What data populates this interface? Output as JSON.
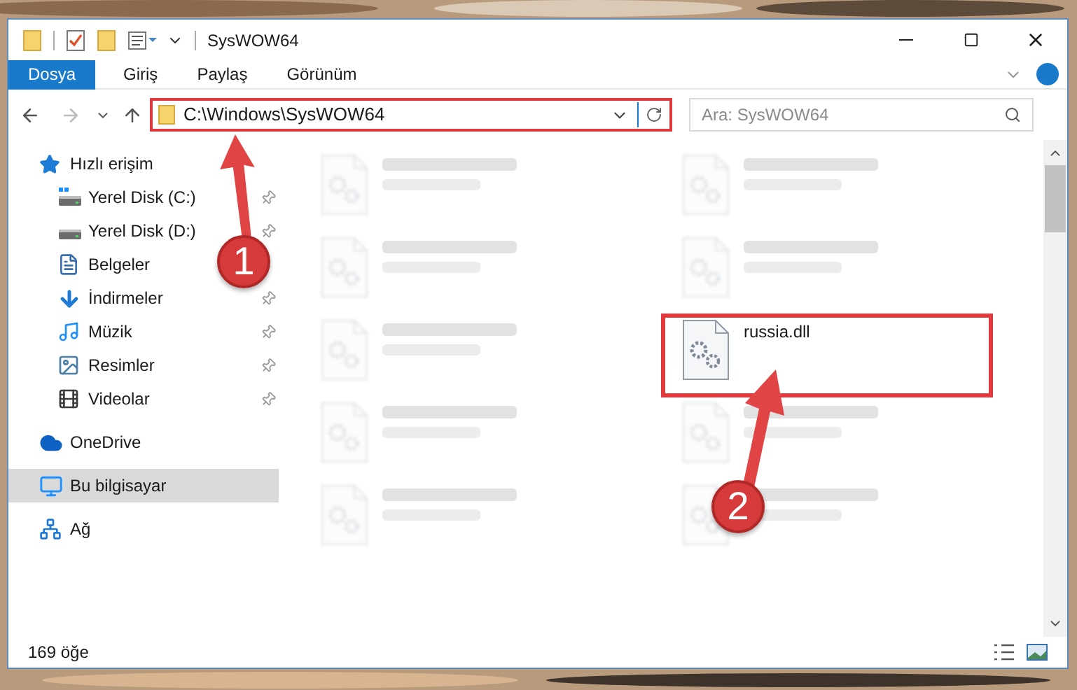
{
  "window": {
    "title": "SysWOW64"
  },
  "ribbon_tabs": [
    {
      "label": "Dosya",
      "selected": true
    },
    {
      "label": "Giriş",
      "selected": false
    },
    {
      "label": "Paylaş",
      "selected": false
    },
    {
      "label": "Görünüm",
      "selected": false
    }
  ],
  "address_bar": {
    "path": "C:\\Windows\\SysWOW64"
  },
  "search": {
    "placeholder": "Ara: SysWOW64"
  },
  "sidebar": [
    {
      "label": "Hızlı erişim",
      "kind": "star",
      "selected": false,
      "children": [
        {
          "label": "Yerel Disk (C:)",
          "kind": "system-drive",
          "selected": false,
          "pinned": true
        },
        {
          "label": "Yerel Disk (D:)",
          "kind": "drive",
          "selected": false,
          "pinned": true
        },
        {
          "label": "Belgeler",
          "kind": "documents",
          "selected": false,
          "pinned": false
        },
        {
          "label": "İndirmeler",
          "kind": "downloads",
          "selected": false,
          "pinned": true
        },
        {
          "label": "Müzik",
          "kind": "music",
          "selected": false,
          "pinned": true
        },
        {
          "label": "Resimler",
          "kind": "pictures",
          "selected": false,
          "pinned": true
        },
        {
          "label": "Videolar",
          "kind": "videos",
          "selected": false,
          "pinned": true
        }
      ]
    },
    {
      "label": "OneDrive",
      "kind": "cloud",
      "selected": false
    },
    {
      "label": "Bu bilgisayar",
      "kind": "computer",
      "selected": true
    },
    {
      "label": "Ağ",
      "kind": "network",
      "selected": false
    }
  ],
  "files": [
    {
      "kind": "blurred"
    },
    {
      "kind": "blurred"
    },
    {
      "kind": "blurred"
    },
    {
      "kind": "blurred"
    },
    {
      "kind": "blurred"
    },
    {
      "kind": "file",
      "name": "russia.dll"
    },
    {
      "kind": "blurred"
    },
    {
      "kind": "blurred"
    },
    {
      "kind": "blurred"
    },
    {
      "kind": "blurred"
    }
  ],
  "status_bar": {
    "item_count": "169 öğe"
  },
  "annotations": [
    {
      "label": "1"
    },
    {
      "label": "2"
    }
  ]
}
